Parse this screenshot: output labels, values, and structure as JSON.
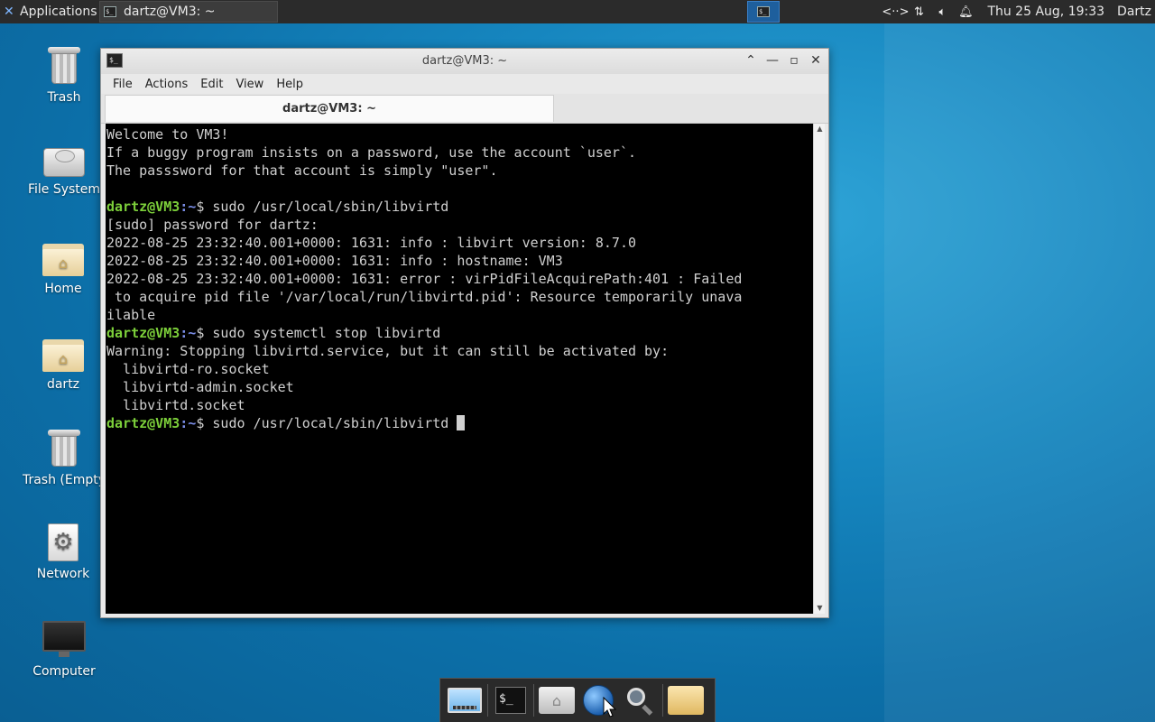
{
  "top_panel": {
    "applications_label": "Applications",
    "task_title": "dartz@VM3: ~",
    "clock": "Thu 25 Aug, 19:33",
    "user": "Dartz",
    "tray_icons": [
      "network-icon",
      "transfer-icon",
      "volume-icon",
      "notification-bell-icon"
    ]
  },
  "desktop": {
    "icons": [
      {
        "label": "Trash",
        "icon": "trash-icon"
      },
      {
        "label": "File System",
        "icon": "drive-icon"
      },
      {
        "label": "Home",
        "icon": "home-folder-icon"
      },
      {
        "label": "dartz",
        "icon": "home-folder-icon"
      },
      {
        "label": "Trash (Empty",
        "icon": "trash-icon"
      },
      {
        "label": "Network",
        "icon": "network-gear-icon"
      },
      {
        "label": "Computer",
        "icon": "monitor-icon"
      }
    ]
  },
  "window": {
    "title": "dartz@VM3: ~",
    "menu": [
      "File",
      "Actions",
      "Edit",
      "View",
      "Help"
    ],
    "tab_label": "dartz@VM3: ~"
  },
  "terminal": {
    "lines": [
      "Welcome to VM3!",
      "If a buggy program insists on a password, use the account `user`.",
      "The passsword for that account is simply \"user\".",
      "",
      {
        "user": "dartz@VM3",
        "path": ":~",
        "cmd": "$ sudo /usr/local/sbin/libvirtd"
      },
      "[sudo] password for dartz:",
      "2022-08-25 23:32:40.001+0000: 1631: info : libvirt version: 8.7.0",
      "2022-08-25 23:32:40.001+0000: 1631: info : hostname: VM3",
      "2022-08-25 23:32:40.001+0000: 1631: error : virPidFileAcquirePath:401 : Failed",
      " to acquire pid file '/var/local/run/libvirtd.pid': Resource temporarily unava",
      "ilable",
      {
        "user": "dartz@VM3",
        "path": ":~",
        "cmd": "$ sudo systemctl stop libvirtd"
      },
      "Warning: Stopping libvirtd.service, but it can still be activated by:",
      "  libvirtd-ro.socket",
      "  libvirtd-admin.socket",
      "  libvirtd.socket",
      {
        "user": "dartz@VM3",
        "path": ":~",
        "cmd": "$ sudo /usr/local/sbin/libvirtd ",
        "cursor": true
      }
    ]
  },
  "dock": {
    "items": [
      "display-icon",
      "terminal-icon",
      "home-icon",
      "web-browser-icon",
      "search-icon",
      "folder-icon"
    ]
  },
  "colors": {
    "prompt_user": "#7ccf3a",
    "prompt_path": "#7b8ee8",
    "terminal_bg": "#000000",
    "terminal_fg": "#d0d0d0"
  }
}
